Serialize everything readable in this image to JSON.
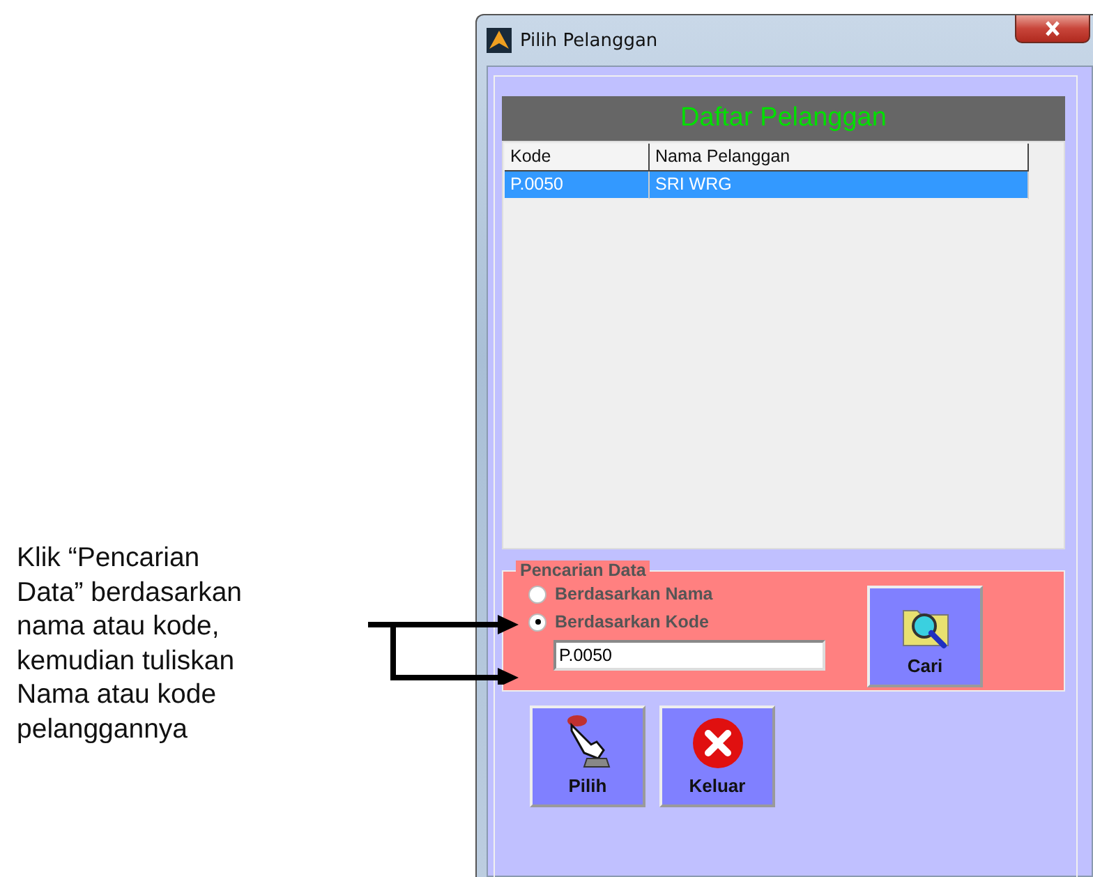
{
  "annotation": "Klik “Pencarian Data” berdasarkan nama atau kode, kemudian tuliskan Nama atau kode pelanggannya",
  "window": {
    "title": "Pilih Pelanggan"
  },
  "list": {
    "title": "Daftar Pelanggan",
    "columns": [
      "Kode",
      "Nama Pelanggan"
    ],
    "rows": [
      {
        "cells": [
          "P.0050",
          "SRI WRG"
        ],
        "selected": true
      }
    ]
  },
  "search": {
    "legend": "Pencarian Data",
    "options": [
      {
        "label": "Berdasarkan Nama",
        "selected": false
      },
      {
        "label": "Berdasarkan Kode",
        "selected": true
      }
    ],
    "value": "P.0050",
    "button": "Cari"
  },
  "buttons": [
    {
      "label": "Pilih",
      "kind": "pointer"
    },
    {
      "label": "Keluar",
      "kind": "exit"
    }
  ]
}
